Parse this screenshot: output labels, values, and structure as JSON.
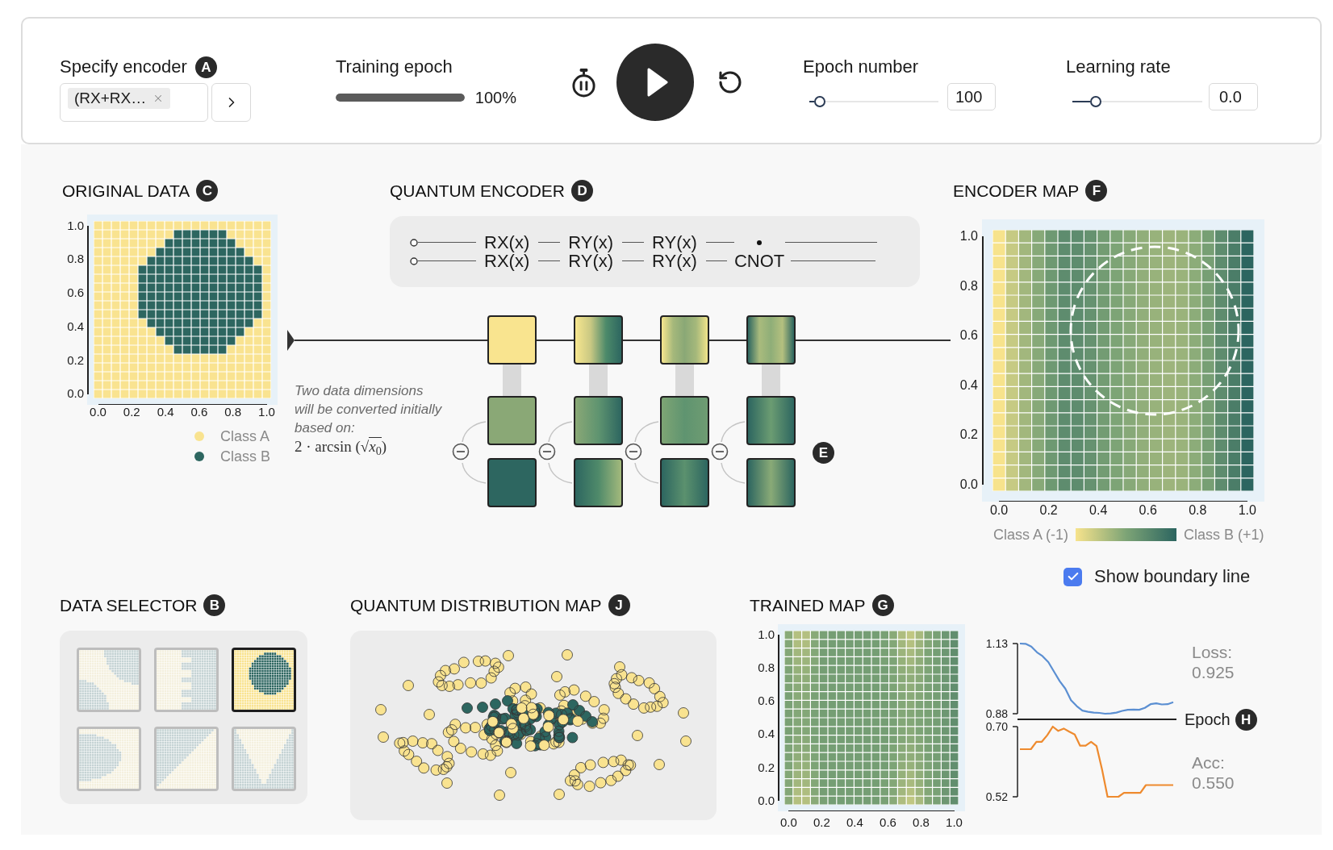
{
  "toolbar": {
    "encoder": {
      "label": "Specify encoder",
      "marker": "A",
      "tag": "(RX+RX…"
    },
    "training_epoch": {
      "label": "Training epoch",
      "level": 1,
      "reading": "100%"
    },
    "playback": {
      "playing": false
    },
    "epoch_number": {
      "label": "Epoch number",
      "level": 0.08,
      "value": "100"
    },
    "learning_rate": {
      "label": "Learning rate",
      "level": 0.18,
      "value": "0.0"
    }
  },
  "original_data": {
    "title": "ORIGINAL DATA",
    "marker": "C",
    "y_ticks": [
      "1.0",
      "0.8",
      "0.6",
      "0.4",
      "0.2",
      "0.0"
    ],
    "x_ticks": [
      "0.0",
      "0.2",
      "0.4",
      "0.6",
      "0.8",
      "1.0"
    ],
    "legend": [
      {
        "label": "Class A",
        "color": "#f9e390"
      },
      {
        "label": "Class B",
        "color": "#2d6660"
      }
    ]
  },
  "quantum_encoder": {
    "title": "QUANTUM ENCODER",
    "marker": "D",
    "circuit_rows": [
      {
        "gates": [
          "RX(x)",
          "RY(x)",
          "RY(x)"
        ],
        "end": {
          "kind": "control"
        }
      },
      {
        "gates": [
          "RX(x)",
          "RY(x)",
          "RY(x)"
        ],
        "end": {
          "kind": "target",
          "label": "CNOT"
        }
      }
    ],
    "note_lines": [
      "Two data dimensions",
      "will be converted initially",
      "based on:"
    ],
    "formula": {
      "before": "2 · arcsin (",
      "radical": "√",
      "radicand": "*x*$_{0}$",
      "after": ")"
    },
    "layers_marker": "E"
  },
  "encoder_map": {
    "title": "ENCODER MAP",
    "marker": "F",
    "y_ticks": [
      "1.0",
      "0.8",
      "0.6",
      "0.4",
      "0.2",
      "0.0"
    ],
    "x_ticks": [
      "0.0",
      "0.2",
      "0.4",
      "0.6",
      "0.8",
      "1.0"
    ],
    "scale_low": "Class A (-1)",
    "scale_high": "Class B (+1)",
    "boundary": {
      "label": "Show boundary line",
      "checked": true
    }
  },
  "data_selector": {
    "title": "DATA SELECTOR",
    "marker": "B",
    "items": [
      {
        "kind": "arcs",
        "selected": false
      },
      {
        "kind": "stripes",
        "selected": false
      },
      {
        "kind": "circle",
        "selected": true
      },
      {
        "kind": "half_circle",
        "selected": false
      },
      {
        "kind": "diagonal",
        "selected": false
      },
      {
        "kind": "wedge",
        "selected": false
      }
    ]
  },
  "distribution_map": {
    "title": "QUANTUM DISTRIBUTION MAP",
    "marker": "J"
  },
  "trained_map": {
    "title": "TRAINED MAP",
    "marker": "G",
    "y_ticks": [
      "1.0",
      "0.8",
      "0.6",
      "0.4",
      "0.2",
      "0.0"
    ],
    "x_ticks": [
      "0.0",
      "0.2",
      "0.4",
      "0.6",
      "0.8",
      "1.0"
    ]
  },
  "training_curves": {
    "axis_label": "Epoch",
    "marker": "H",
    "loss": {
      "label": "Loss:",
      "reading": "0.925",
      "chart_data": {
        "type": "line",
        "ylim": [
          0.88,
          1.13
        ],
        "yticks": [
          {
            "value": 1.13,
            "label": "1.13"
          },
          {
            "value": 0.88,
            "label": "0.88"
          }
        ],
        "series": [
          {
            "color": "#5b8fd2",
            "values": [
              1.13,
              1.129,
              1.119,
              1.099,
              1.085,
              1.064,
              1.03,
              0.996,
              0.969,
              0.928,
              0.907,
              0.891,
              0.887,
              0.884,
              0.883,
              0.88,
              0.881,
              0.884,
              0.89,
              0.894,
              0.895,
              0.894,
              0.901,
              0.914,
              0.917,
              0.913,
              0.914,
              0.921
            ]
          }
        ]
      }
    },
    "accuracy": {
      "label": "Acc:",
      "reading": "0.550",
      "chart_data": {
        "type": "line",
        "ylim": [
          0.52,
          0.7
        ],
        "yticks": [
          {
            "value": 0.7,
            "label": "0.70"
          },
          {
            "value": 0.52,
            "label": "0.52"
          }
        ],
        "series": [
          {
            "color": "#ee8a2e",
            "values": [
              0.642,
              0.642,
              0.642,
              0.661,
              0.661,
              0.678,
              0.7,
              0.689,
              0.695,
              0.687,
              0.68,
              0.651,
              0.651,
              0.661,
              0.65,
              0.59,
              0.52,
              0.52,
              0.52,
              0.53,
              0.53,
              0.53,
              0.53,
              0.55,
              0.55,
              0.55,
              0.55,
              0.55,
              0.55
            ]
          }
        ]
      }
    }
  }
}
